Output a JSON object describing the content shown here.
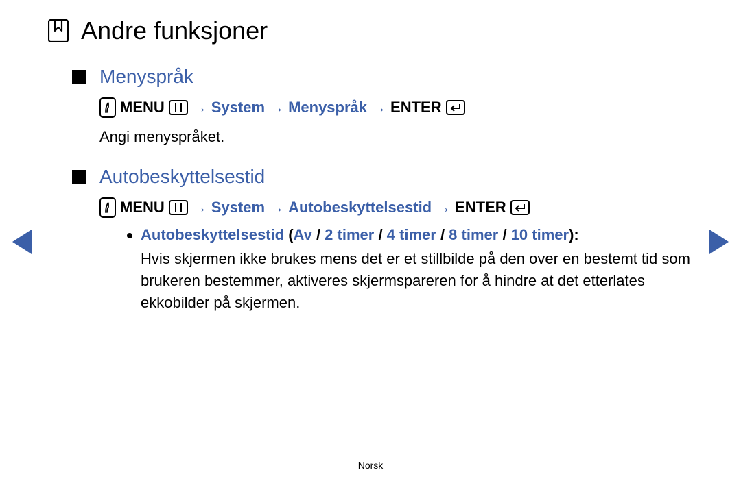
{
  "page_title": "Andre funksjoner",
  "sections": [
    {
      "title": "Menyspråk",
      "path": {
        "menu_label": "MENU",
        "arrow": "→",
        "p1": "System",
        "p2": "Menyspråk",
        "enter_label": "ENTER"
      },
      "desc": "Angi menyspråket."
    },
    {
      "title": "Autobeskyttelsestid",
      "path": {
        "menu_label": "MENU",
        "arrow": "→",
        "p1": "System",
        "p2": "Autobeskyttelsestid",
        "enter_label": "ENTER"
      },
      "bullet": {
        "label": "Autobeskyttelsestid",
        "options_open": "(",
        "opt1": "Av",
        "sep": " / ",
        "opt2": "2 timer",
        "opt3": "4 timer",
        "opt4": "8 timer",
        "opt5": "10 timer",
        "options_close": ")",
        "colon": ":",
        "desc": "Hvis skjermen ikke brukes mens det er et stillbilde på den over en bestemt tid som brukeren bestemmer, aktiveres skjermspareren for å hindre at det etterlates ekkobilder på skjermen."
      }
    }
  ],
  "footer": "Norsk"
}
